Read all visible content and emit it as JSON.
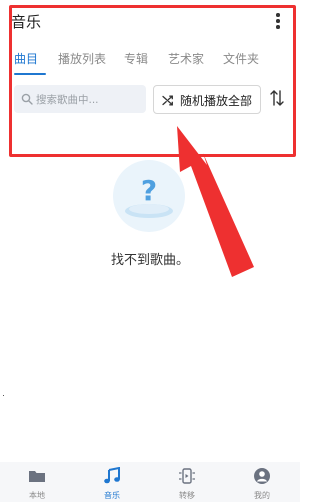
{
  "header": {
    "title": "音乐",
    "more_icon": "more-vertical-icon"
  },
  "tabs": [
    {
      "label": "曲目",
      "active": true
    },
    {
      "label": "播放列表",
      "active": false
    },
    {
      "label": "专辑",
      "active": false
    },
    {
      "label": "艺术家",
      "active": false
    },
    {
      "label": "文件夹",
      "active": false
    }
  ],
  "search": {
    "placeholder": "搜索歌曲中...",
    "icon": "search-icon"
  },
  "shuffle": {
    "label": "随机播放全部",
    "icon": "shuffle-icon"
  },
  "sort": {
    "icon": "sort-arrows-icon"
  },
  "empty_state": {
    "message": "找不到歌曲。",
    "icon": "question-mark-icon"
  },
  "bottom_nav": [
    {
      "label": "本地",
      "icon": "folder-icon",
      "active": false
    },
    {
      "label": "音乐",
      "icon": "music-note-icon",
      "active": true
    },
    {
      "label": "转移",
      "icon": "transfer-icon",
      "active": false
    },
    {
      "label": "我的",
      "icon": "profile-icon",
      "active": false
    }
  ],
  "colors": {
    "accent": "#1f77d0",
    "annotation": "#ee3030",
    "text": "#222222",
    "muted": "#8a8a8a"
  }
}
